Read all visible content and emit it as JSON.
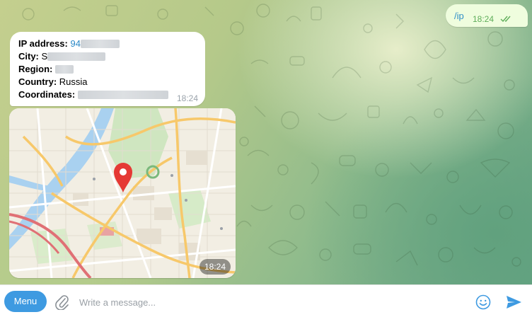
{
  "messages": {
    "outgoing": {
      "text": "/ip",
      "time": "18:24",
      "status": "read"
    },
    "info": {
      "ip_label": "IP address:",
      "ip_value": "94",
      "city_label": "City:",
      "city_value": "S",
      "region_label": "Region:",
      "country_label": "Country:",
      "country_value": "Russia",
      "coords_label": "Coordinates:",
      "time": "18:24"
    },
    "map": {
      "time": "18:24",
      "pin_icon": "location-pin-icon"
    }
  },
  "composer": {
    "menu_label": "Menu",
    "placeholder": "Write a message...",
    "attach_icon": "paperclip-icon",
    "emoji_icon": "emoji-icon",
    "send_icon": "send-icon"
  },
  "colors": {
    "outgoing_bubble": "#effdde",
    "accent": "#3e9ae1",
    "link": "#2a88c6",
    "map_pin": "#e53935"
  }
}
